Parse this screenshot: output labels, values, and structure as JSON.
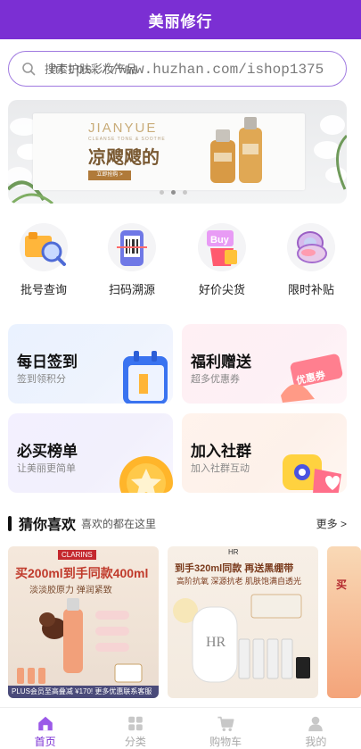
{
  "header": {
    "title": "美丽修行"
  },
  "search": {
    "placeholder": "搜索护肤彩妆产品",
    "watermark": "https://www.huzhan.com/ishop1375"
  },
  "banner": {
    "brand": "JIANYUE",
    "sub": "CLEANSE TONE & SOOTHE",
    "slogan": "凉飕飕的",
    "button": "立即抢购 >"
  },
  "quick_links": [
    {
      "label": "批号查询",
      "icon": "batch-search-icon"
    },
    {
      "label": "扫码溯源",
      "icon": "scan-code-icon"
    },
    {
      "label": "好价尖货",
      "icon": "good-price-icon"
    },
    {
      "label": "限时补贴",
      "icon": "subsidy-icon"
    }
  ],
  "cards": [
    {
      "title": "每日签到",
      "sub": "签到领积分",
      "icon": "calendar-icon"
    },
    {
      "title": "福利赠送",
      "sub": "超多优惠券",
      "icon": "coupon-icon",
      "tag": "优惠券"
    },
    {
      "title": "必买榜单",
      "sub": "让美丽更简单",
      "icon": "star-coin-icon"
    },
    {
      "title": "加入社群",
      "sub": "加入社群互动",
      "icon": "chat-bubble-icon"
    }
  ],
  "recommend": {
    "title": "猜你喜欢",
    "subtitle": "喜欢的都在这里",
    "more": "更多 >"
  },
  "products": [
    {
      "brand": "CLARINS",
      "headline": "买200ml到手同款400ml",
      "sub": "淡淡胶原力 弹润紧致",
      "strip": "PLUS会员至高叠减 ¥170!  更多优惠联系客服"
    },
    {
      "brand": "HR",
      "headline": "到手320ml同款 再送黑绷带",
      "sub": "高阶抗氧 深源抗老 肌肤饱满自透光"
    },
    {
      "brand": "",
      "headline": "买"
    }
  ],
  "tabbar": [
    {
      "label": "首页",
      "icon": "home-icon",
      "active": true
    },
    {
      "label": "分类",
      "icon": "category-icon",
      "active": false
    },
    {
      "label": "购物车",
      "icon": "cart-icon",
      "active": false
    },
    {
      "label": "我的",
      "icon": "profile-icon",
      "active": false
    }
  ],
  "colors": {
    "primary": "#7b2fd3"
  }
}
